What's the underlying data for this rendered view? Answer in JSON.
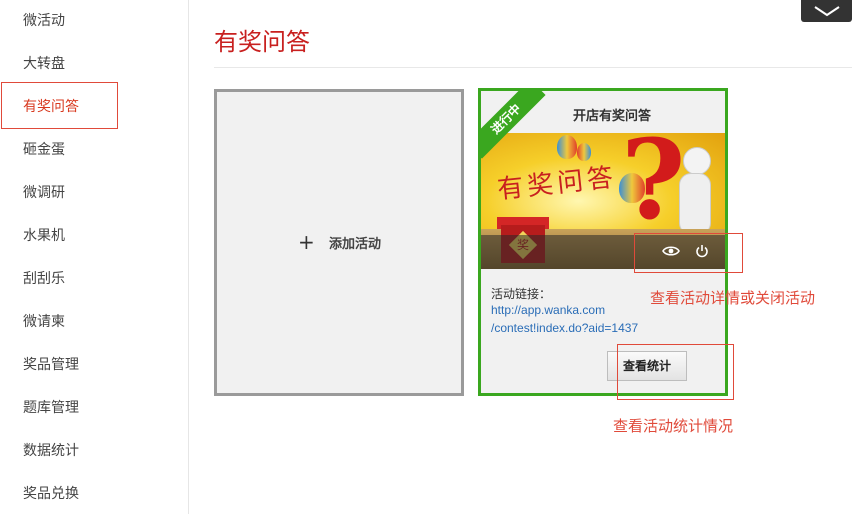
{
  "sidebar": {
    "items": [
      {
        "label": "微活动"
      },
      {
        "label": "大转盘"
      },
      {
        "label": "有奖问答"
      },
      {
        "label": "砸金蛋"
      },
      {
        "label": "微调研"
      },
      {
        "label": "水果机"
      },
      {
        "label": "刮刮乐"
      },
      {
        "label": "微请柬"
      },
      {
        "label": "奖品管理"
      },
      {
        "label": "题库管理"
      },
      {
        "label": "数据统计"
      },
      {
        "label": "奖品兑换"
      }
    ],
    "active_index": 2
  },
  "page": {
    "title": "有奖问答"
  },
  "add_card": {
    "plus": "+",
    "label": "添加活动"
  },
  "activity_card": {
    "status": "进行中",
    "title": "开店有奖问答",
    "banner_text": "有奖问答",
    "gift_char": "奖",
    "link_label": "活动链接：",
    "link_line1": "http://app.wanka.com",
    "link_line2": "/contest!index.do?aid=1437",
    "stats_button": "查看统计"
  },
  "annotations": {
    "view_close": "查看活动详情或关闭活动",
    "stats": "查看活动统计情况"
  },
  "colors": {
    "accent_red": "#c8201f",
    "active_green": "#3aa71f",
    "annotation_red": "#e04a3a",
    "link_blue": "#2a6db7"
  },
  "icons": [
    "chevron-down-icon",
    "plus-icon",
    "eye-icon",
    "power-icon"
  ]
}
